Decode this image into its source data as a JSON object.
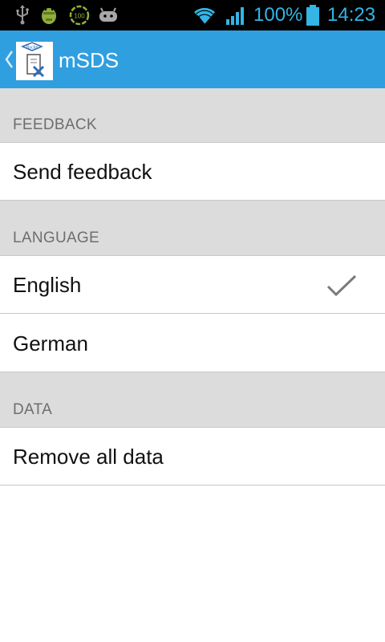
{
  "status_bar": {
    "battery": "100%",
    "time": "14:23",
    "icons": [
      "usb-icon",
      "android-debug-icon",
      "battery-full-notification-icon",
      "android-gamepad-icon",
      "wifi-icon",
      "signal-icon",
      "battery-icon"
    ],
    "accent_color": "#33b5e5"
  },
  "action_bar": {
    "title": "mSDS",
    "icons": [
      "back-chevron-icon",
      "app-icon"
    ],
    "background_color": "#2f9fe0"
  },
  "sections": [
    {
      "header": "FEEDBACK",
      "items": [
        {
          "label": "Send feedback"
        }
      ]
    },
    {
      "header": "LANGUAGE",
      "items": [
        {
          "label": "English",
          "selected": true,
          "icon": "checkmark-icon"
        },
        {
          "label": "German",
          "selected": false
        }
      ]
    },
    {
      "header": "DATA",
      "items": [
        {
          "label": "Remove all data"
        }
      ]
    }
  ]
}
